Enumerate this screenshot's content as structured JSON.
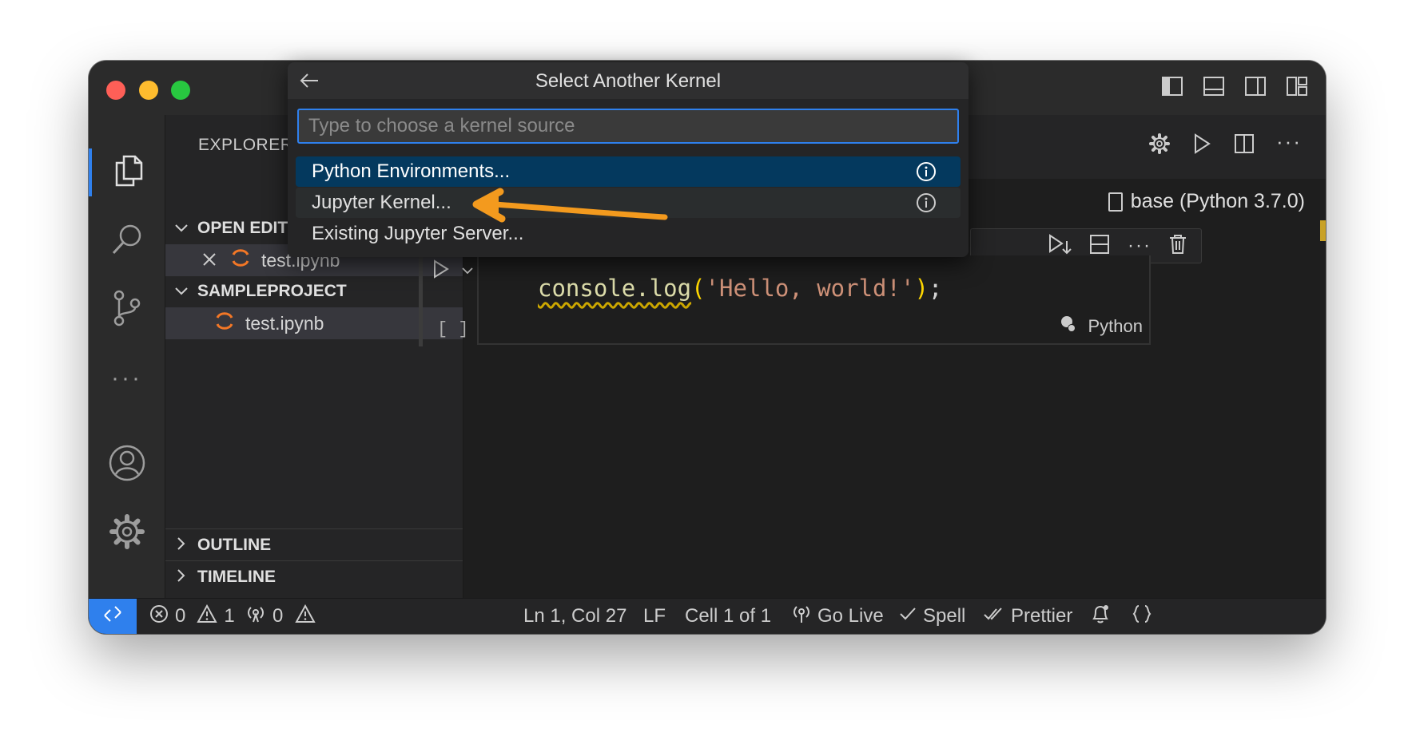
{
  "sidebar": {
    "title": "EXPLORER",
    "open_editors_label": "OPEN EDITORS",
    "open_editor_file": "test.ipynb",
    "project_label": "SAMPLEPROJECT",
    "project_file": "test.ipynb",
    "outline_label": "OUTLINE",
    "timeline_label": "TIMELINE"
  },
  "palette": {
    "title": "Select Another Kernel",
    "placeholder": "Type to choose a kernel source",
    "items": [
      {
        "label": "Python Environments..."
      },
      {
        "label": "Jupyter Kernel..."
      },
      {
        "label": "Existing Jupyter Server..."
      }
    ]
  },
  "editor": {
    "kernel": "base (Python 3.7.0)",
    "code": {
      "fn": "console.log",
      "open": "(",
      "str": "'Hello, world!'",
      "close": ")",
      "end": ";"
    },
    "cell_count": "[ ]",
    "cell_language": "Python"
  },
  "status": {
    "errors": "0",
    "warnings": "1",
    "ports": "0",
    "position": "Ln 1, Col 27",
    "eol": "LF",
    "cell": "Cell 1 of 1",
    "go_live": "Go Live",
    "spell": "Spell",
    "prettier": "Prettier"
  },
  "colors": {
    "accent": "#2f80ed",
    "selection": "#04395e",
    "jupyter_orange": "#f37726",
    "annotation_arrow": "#f39a1e"
  },
  "icons": [
    "back-arrow-icon",
    "info-icon",
    "files-icon",
    "search-icon",
    "source-control-icon",
    "more-icon",
    "account-icon",
    "settings-gear-icon",
    "close-icon",
    "jupyter-icon",
    "chevron-down-icon",
    "chevron-right-icon",
    "run-icon",
    "split-editor-icon",
    "run-below-icon",
    "split-cell-icon",
    "trash-icon",
    "kernel-icon",
    "error-icon",
    "warning-icon",
    "broadcast-icon",
    "bell-icon",
    "braces-icon",
    "remote-icon"
  ]
}
